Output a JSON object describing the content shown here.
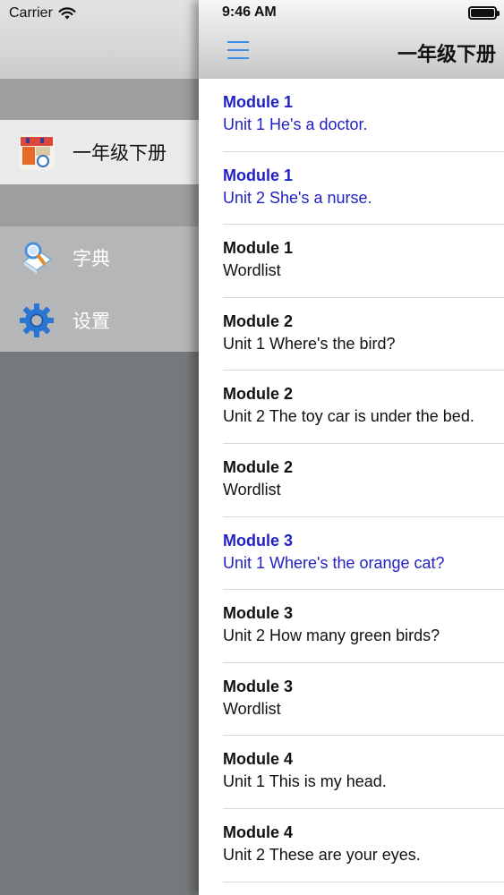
{
  "status_bar": {
    "carrier": "Carrier",
    "time": "9:46 AM"
  },
  "menu": {
    "items": [
      {
        "label": "一年级下册",
        "icon": "book-cover-icon",
        "selected": true
      },
      {
        "label": "字典",
        "icon": "dictionary-icon",
        "selected": false
      },
      {
        "label": "设置",
        "icon": "gear-icon",
        "selected": false
      }
    ]
  },
  "nav": {
    "title": "一年级下册",
    "menu_icon": "hamburger-icon"
  },
  "lessons": [
    {
      "module": "Module 1",
      "unit": "Unit 1 He's a doctor.",
      "highlighted": true
    },
    {
      "module": "Module 1",
      "unit": "Unit 2 She's a nurse.",
      "highlighted": true
    },
    {
      "module": "Module 1",
      "unit": "Wordlist",
      "highlighted": false
    },
    {
      "module": "Module 2",
      "unit": "Unit 1 Where's the bird?",
      "highlighted": false
    },
    {
      "module": "Module 2",
      "unit": "Unit 2 The toy car is under the bed.",
      "highlighted": false
    },
    {
      "module": "Module 2",
      "unit": "Wordlist",
      "highlighted": false
    },
    {
      "module": "Module 3",
      "unit": "Unit 1 Where's the orange cat?",
      "highlighted": true
    },
    {
      "module": "Module 3",
      "unit": "Unit 2 How many green birds?",
      "highlighted": false
    },
    {
      "module": "Module 3",
      "unit": "Wordlist",
      "highlighted": false
    },
    {
      "module": "Module 4",
      "unit": "Unit 1 This is my head.",
      "highlighted": false
    },
    {
      "module": "Module 4",
      "unit": "Unit 2 These are your eyes.",
      "highlighted": false
    }
  ],
  "colors": {
    "highlight": "#2222c4",
    "accent": "#3a8ee6"
  }
}
